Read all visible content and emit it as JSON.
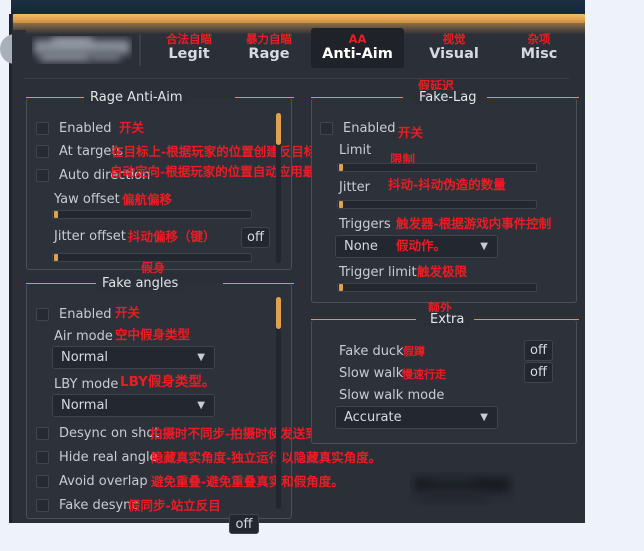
{
  "app": {
    "logo_alt": "blurred-logo",
    "active_tab": "Anti-Aim"
  },
  "tabs": [
    {
      "cn": "合法自瞄",
      "en": "Legit",
      "active": false
    },
    {
      "cn": "暴力自瞄",
      "en": "Rage",
      "active": false
    },
    {
      "cn": "AA",
      "en": "Anti-Aim",
      "active": true
    },
    {
      "cn": "视觉",
      "en": "Visual",
      "active": false
    },
    {
      "cn": "杂项",
      "en": "Misc",
      "active": false
    }
  ],
  "groups": {
    "rage_anti_aim": {
      "title": "Rage Anti-Aim",
      "title_cn": "",
      "rows": {
        "enabled": {
          "label": "Enabled",
          "cn": "开关"
        },
        "at_targets": {
          "label": "At targets",
          "cn": "在目标上-根据玩家的位置创建反目标更改。"
        },
        "auto_direction": {
          "label": "Auto direction",
          "cn": "自动定向-根据玩家的位置自动应用最安全的定向。"
        },
        "yaw_offset": {
          "label": "Yaw offset",
          "cn": "偏航偏移"
        },
        "jitter_offset": {
          "label": "Jitter offset",
          "cn": "抖动偏移（键）",
          "button": "off"
        }
      }
    },
    "fake_angles": {
      "title": "Fake angles",
      "title_cn": "假身",
      "rows": {
        "enabled": {
          "label": "Enabled",
          "cn": "开关"
        },
        "air_mode": {
          "label": "Air mode",
          "cn": "空中假身类型",
          "value": "Normal"
        },
        "lby_mode": {
          "label": "LBY mode",
          "cn": "LBY假身类型。",
          "value": "Normal"
        },
        "desync_on_shot": {
          "label": "Desync on shot",
          "cn": "拍摄时不同步-拍摄时使发送到服务器的动画不同步。"
        },
        "hide_real_angle": {
          "label": "Hide real angle",
          "cn": "隐藏真实角度-独立运行以隐藏真实角度。"
        },
        "avoid_overlap": {
          "label": "Avoid overlap",
          "cn": "避免重叠-避免重叠真实和假角度。"
        },
        "fake_desync": {
          "label": "Fake desync",
          "cn": "假同步-站立反目"
        },
        "cut_off": {
          "label": "",
          "button": "off"
        }
      }
    },
    "fake_lag": {
      "title": "Fake-Lag",
      "title_cn": "假延迟",
      "rows": {
        "enabled": {
          "label": "Enabled",
          "cn": "开关"
        },
        "limit": {
          "label": "Limit",
          "cn": "限制"
        },
        "jitter": {
          "label": "Jitter",
          "cn": "抖动-抖动伪造的数量"
        },
        "triggers": {
          "label": "Triggers",
          "cn": "触发器-根据游戏内事件控制",
          "cn2": "假动作。",
          "value": "None"
        },
        "trigger_limit": {
          "label": "Trigger limit",
          "cn": "触发极限"
        }
      }
    },
    "extra": {
      "title": "Extra",
      "title_cn": "额外",
      "rows": {
        "fake_duck": {
          "label": "Fake duck",
          "cn": "假蹲",
          "button": "off"
        },
        "slow_walk": {
          "label": "Slow walk",
          "cn": "慢速行走",
          "button": "off"
        },
        "slow_walk_mode": {
          "label": "Slow walk mode",
          "cn": "",
          "value": "Accurate"
        }
      }
    }
  },
  "colors": {
    "accent_gold": "#e2a351",
    "annotation_red": "#ec1c24",
    "panel_bg": "#2d313a",
    "window_bg": "#2b2f38",
    "page_bg": "#eef2fa"
  }
}
